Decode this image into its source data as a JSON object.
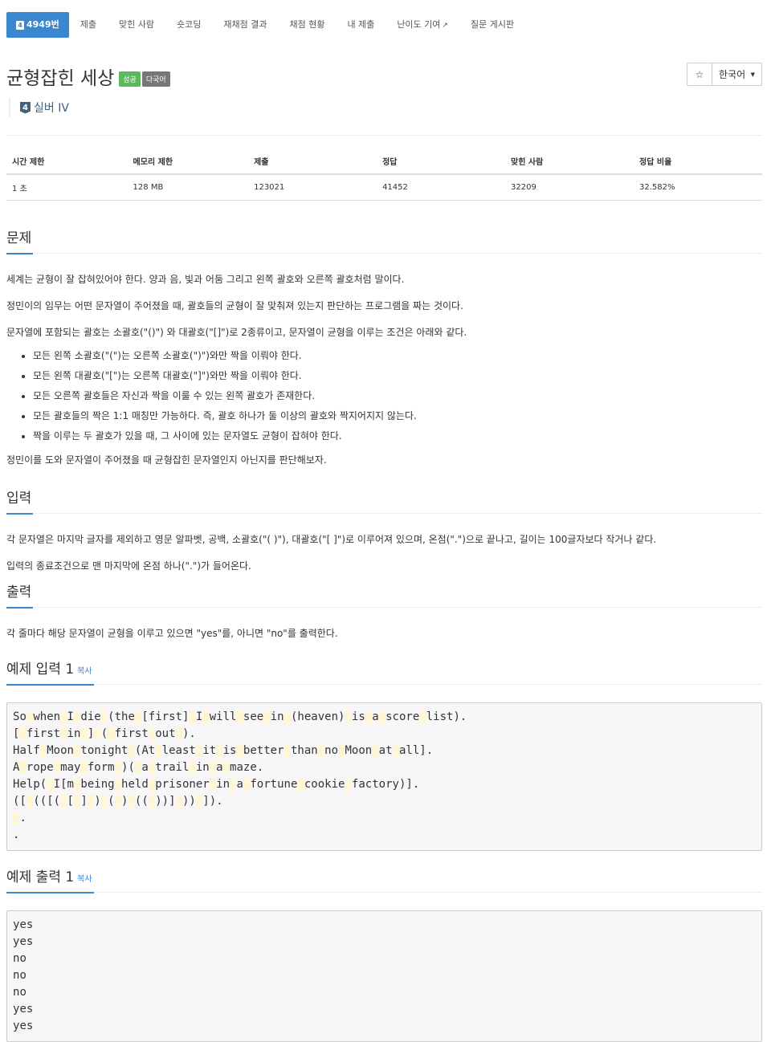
{
  "tabs": [
    {
      "label": "4949번",
      "tier": "4",
      "active": true
    },
    {
      "label": "제출"
    },
    {
      "label": "맞힌 사람"
    },
    {
      "label": "숏코딩"
    },
    {
      "label": "재채점 결과"
    },
    {
      "label": "채점 현황"
    },
    {
      "label": "내 제출"
    },
    {
      "label": "난이도 기여",
      "external": true
    },
    {
      "label": "질문 게시판"
    }
  ],
  "problem": {
    "title": "균형잡힌 세상",
    "badge_success": "성공",
    "badge_multilang": "다국어",
    "tier_number": "4",
    "tier_label": "실버 IV"
  },
  "controls": {
    "star": "☆",
    "language": "한국어"
  },
  "info_table": {
    "headers": [
      "시간 제한",
      "메모리 제한",
      "제출",
      "정답",
      "맞힌 사람",
      "정답 비율"
    ],
    "values": [
      "1 초",
      "128 MB",
      "123021",
      "41452",
      "32209",
      "32.582%"
    ]
  },
  "sections": {
    "problem_title": "문제",
    "problem_paragraphs": [
      "세계는 균형이 잘 잡혀있어야 한다. 양과 음, 빛과 어둠 그리고 왼쪽 괄호와 오른쪽 괄호처럼 말이다.",
      "정민이의 임무는 어떤 문자열이 주어졌을 때, 괄호들의 균형이 잘 맞춰져 있는지 판단하는 프로그램을 짜는 것이다.",
      "문자열에 포함되는 괄호는 소괄호(\"()\") 와 대괄호(\"[]\")로 2종류이고, 문자열이 균형을 이루는 조건은 아래와 같다."
    ],
    "rules": [
      "모든 왼쪽 소괄호(\"(\")는 오른쪽 소괄호(\")\")와만 짝을 이뤄야 한다.",
      "모든 왼쪽 대괄호(\"[\")는 오른쪽 대괄호(\"]\")와만 짝을 이뤄야 한다.",
      "모든 오른쪽 괄호들은 자신과 짝을 이룰 수 있는 왼쪽 괄호가 존재한다.",
      "모든 괄호들의 짝은 1:1 매칭만 가능하다. 즉, 괄호 하나가 둘 이상의 괄호와 짝지어지지 않는다.",
      "짝을 이루는 두 괄호가 있을 때, 그 사이에 있는 문자열도 균형이 잡혀야 한다."
    ],
    "problem_closing": "정민이를 도와 문자열이 주어졌을 때 균형잡힌 문자열인지 아닌지를 판단해보자.",
    "input_title": "입력",
    "input_paragraphs": [
      "각 문자열은 마지막 글자를 제외하고 영문 알파벳, 공백, 소괄호(\"( )\"), 대괄호(\"[ ]\")로 이루어져 있으며, 온점(\".\")으로 끝나고, 길이는 100글자보다 작거나 같다.",
      "입력의 종료조건으로 맨 마지막에 온점 하나(\".\")가 들어온다."
    ],
    "output_title": "출력",
    "output_paragraph": "각 줄마다 해당 문자열이 균형을 이루고 있으면 \"yes\"를, 아니면 \"no\"를 출력한다.",
    "sample_input_title": "예제 입력 1",
    "sample_output_title": "예제 출력 1",
    "copy_label": "복사"
  },
  "sample_input": [
    "So when I die (the [first] I will see in (heaven) is a score list).",
    "[ first in ] ( first out ).",
    "Half Moon tonight (At least it is better than no Moon at all].",
    "A rope may form )( a trail in a maze.",
    "Help( I[m being held prisoner in a fortune cookie factory)].",
    "([ (([( [ ] ) ( ) (( ))] )) ]).",
    " .",
    "."
  ],
  "sample_output": [
    "yes",
    "yes",
    "no",
    "no",
    "no",
    "yes",
    "yes"
  ]
}
